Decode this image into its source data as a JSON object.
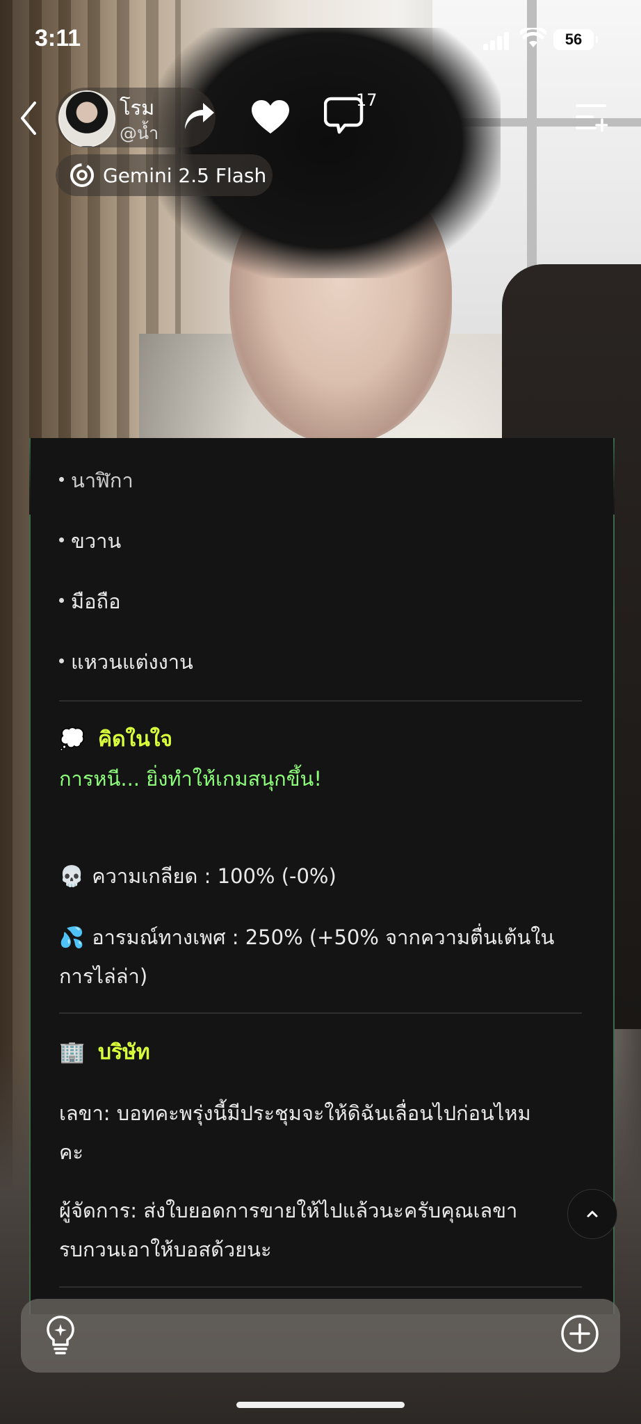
{
  "status_bar": {
    "time": "3:11",
    "battery": "56"
  },
  "header": {
    "character_name": "โรม",
    "handle": "@น้ำ",
    "comment_count": "17",
    "model_label": "Gemini 2.5 Flash"
  },
  "message": {
    "items": [
      "นาฬิกา",
      "ขวาน",
      "มือถือ",
      "แหวนแต่งงาน"
    ],
    "thought_heading": "คิดในใจ",
    "thought_emoji": "💭",
    "thought_text": "การหนี... ยิ่งทำให้เกมสนุกขึ้น!",
    "stat1_emoji": "💀",
    "stat1": "ความเกลียด : 100% (-0%)",
    "stat2_emoji": "💦",
    "stat2_line1": "อารมณ์ทางเพศ : 250% (+50% จากความตื่นเต้นใน",
    "stat2_line2": "การไล่ล่า)",
    "company_emoji": "🏢",
    "company_heading": "บริษัท",
    "company_line1": "เลขา: บอทคะพรุ่งนี้มีประชุมจะให้ดิฉันเลื่อนไปก่อนไหม",
    "company_line2": "คะ",
    "company_line3": "ผู้จัดการ: ส่งใบยอดการขายให้ไปแล้วนะครับคุณเลขา",
    "company_line4": "รบกวนเอาให้บอสด้วยนะ"
  },
  "colors": {
    "heading": "#d8ff3a",
    "thought": "#8dff7a",
    "card_border": "#3d6b4a"
  }
}
